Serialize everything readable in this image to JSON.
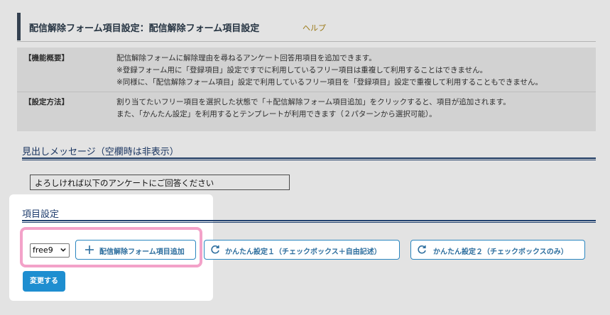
{
  "header": {
    "title": "配信解除フォーム項目設定：配信解除フォーム項目設定",
    "help": "ヘルプ"
  },
  "info": {
    "overview_label": "【機能概要】",
    "overview_lines": [
      "配信解除フォームに解除理由を尋ねるアンケート回答用項目を追加できます。",
      "※登録フォーム用に「登録項目」設定ですでに利用しているフリー項目は重複して利用することはできません。",
      "※同様に、「配信解除フォーム項目」設定で利用しているフリー項目を「登録項目」設定で重複して利用することもできません。"
    ],
    "method_label": "【設定方法】",
    "method_lines": [
      "割り当てたいフリー項目を選択した状態で「＋配信解除フォーム項目追加」をクリックすると、項目が追加されます。",
      "また、「かんたん設定」を利用するとテンプレートが利用できます（２パターンから選択可能）。"
    ]
  },
  "heading_message": {
    "title": "見出しメッセージ（空欄時は非表示）",
    "value": "よろしければ以下のアンケートにご回答ください"
  },
  "item_settings": {
    "title": "項目設定",
    "select_value": "free9",
    "add_button": "配信解除フォーム項目追加",
    "easy1_button": "かんたん設定１（チェックボックス＋自由記述）",
    "easy2_button": "かんたん設定２（チェックボックスのみ）",
    "submit_button": "変更する"
  },
  "icons": {
    "add": "plus-icon",
    "easy": "refresh-icon",
    "select": "chevron-down-icon"
  },
  "colors": {
    "accent": "#1e8ed0",
    "heading": "#20416f",
    "highlight": "#f3a2c9",
    "help": "#b08b1e"
  }
}
